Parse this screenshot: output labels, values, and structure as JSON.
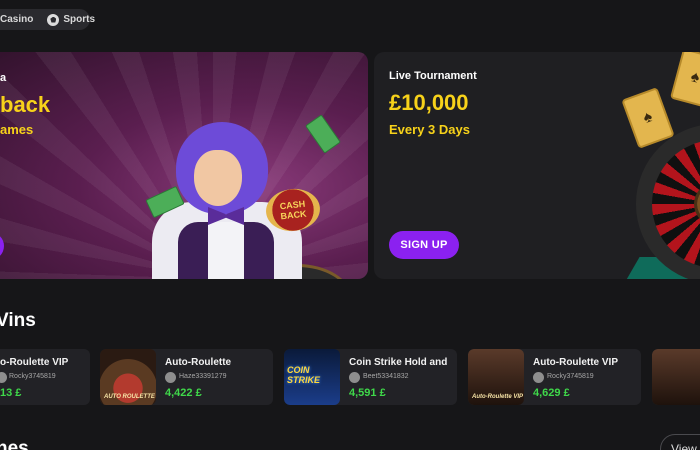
{
  "topnav": {
    "casino_label": "Casino",
    "sports_label": "Sports"
  },
  "promo_cashback": {
    "eyebrow": "a",
    "title": "back",
    "subtitle": "ames",
    "badge_line1": "CASH",
    "badge_line2": "BACK"
  },
  "promo_tournament": {
    "eyebrow": "Live Tournament",
    "title": "£10,000",
    "subtitle": "Every 3 Days",
    "cta_label": "SIGN UP"
  },
  "wins": {
    "heading": "Vins",
    "items": [
      {
        "game": "o-Roulette VIP",
        "user": "Rocky3745819",
        "amount": "13 £"
      },
      {
        "game": "Auto-Roulette",
        "user": "Haze33391279",
        "amount": "4,422 £"
      },
      {
        "game": "Coin Strike Hold and",
        "user": "Beet53341832",
        "amount": "4,591 £"
      },
      {
        "game": "Auto-Roulette VIP",
        "user": "Rocky3745819",
        "amount": "4,629 £"
      }
    ],
    "thumb_labels": {
      "roulette": "AUTO ROULETTE",
      "coin": "COIN STRIKE",
      "vip": "Auto-Roulette VIP"
    }
  },
  "games": {
    "heading": "nes",
    "view_label": "View"
  },
  "colors": {
    "accent": "#8b21f0",
    "gold": "#f7d21a",
    "win_green": "#3fd84a"
  }
}
